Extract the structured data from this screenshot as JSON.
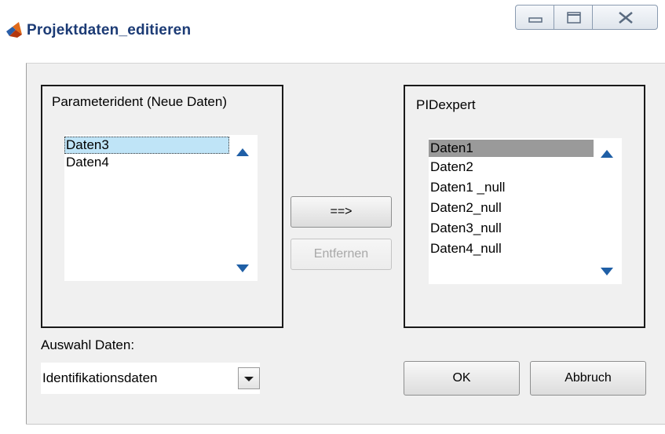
{
  "window": {
    "title": "Projektdaten_editieren"
  },
  "left_panel": {
    "title": "Parameterident (Neue Daten)",
    "items": [
      "Daten3",
      "Daten4"
    ]
  },
  "right_panel": {
    "title": "PIDexpert",
    "items": [
      "Daten1",
      "Daten2",
      "Daten1 _null",
      "Daten2_null",
      "Daten3_null",
      "Daten4_null"
    ]
  },
  "transfer_button": {
    "label": "==>"
  },
  "remove_button": {
    "label": "Entfernen",
    "enabled": false
  },
  "selection": {
    "label": "Auswahl Daten:",
    "value": "Identifikationsdaten"
  },
  "ok_button": {
    "label": "OK"
  },
  "cancel_button": {
    "label": "Abbruch"
  },
  "colors": {
    "title_text": "#1c3b75",
    "focused_selection": "#bfe4f7",
    "grey_selection": "#9a9a9a",
    "scroll_arrow": "#1f5fa6"
  }
}
